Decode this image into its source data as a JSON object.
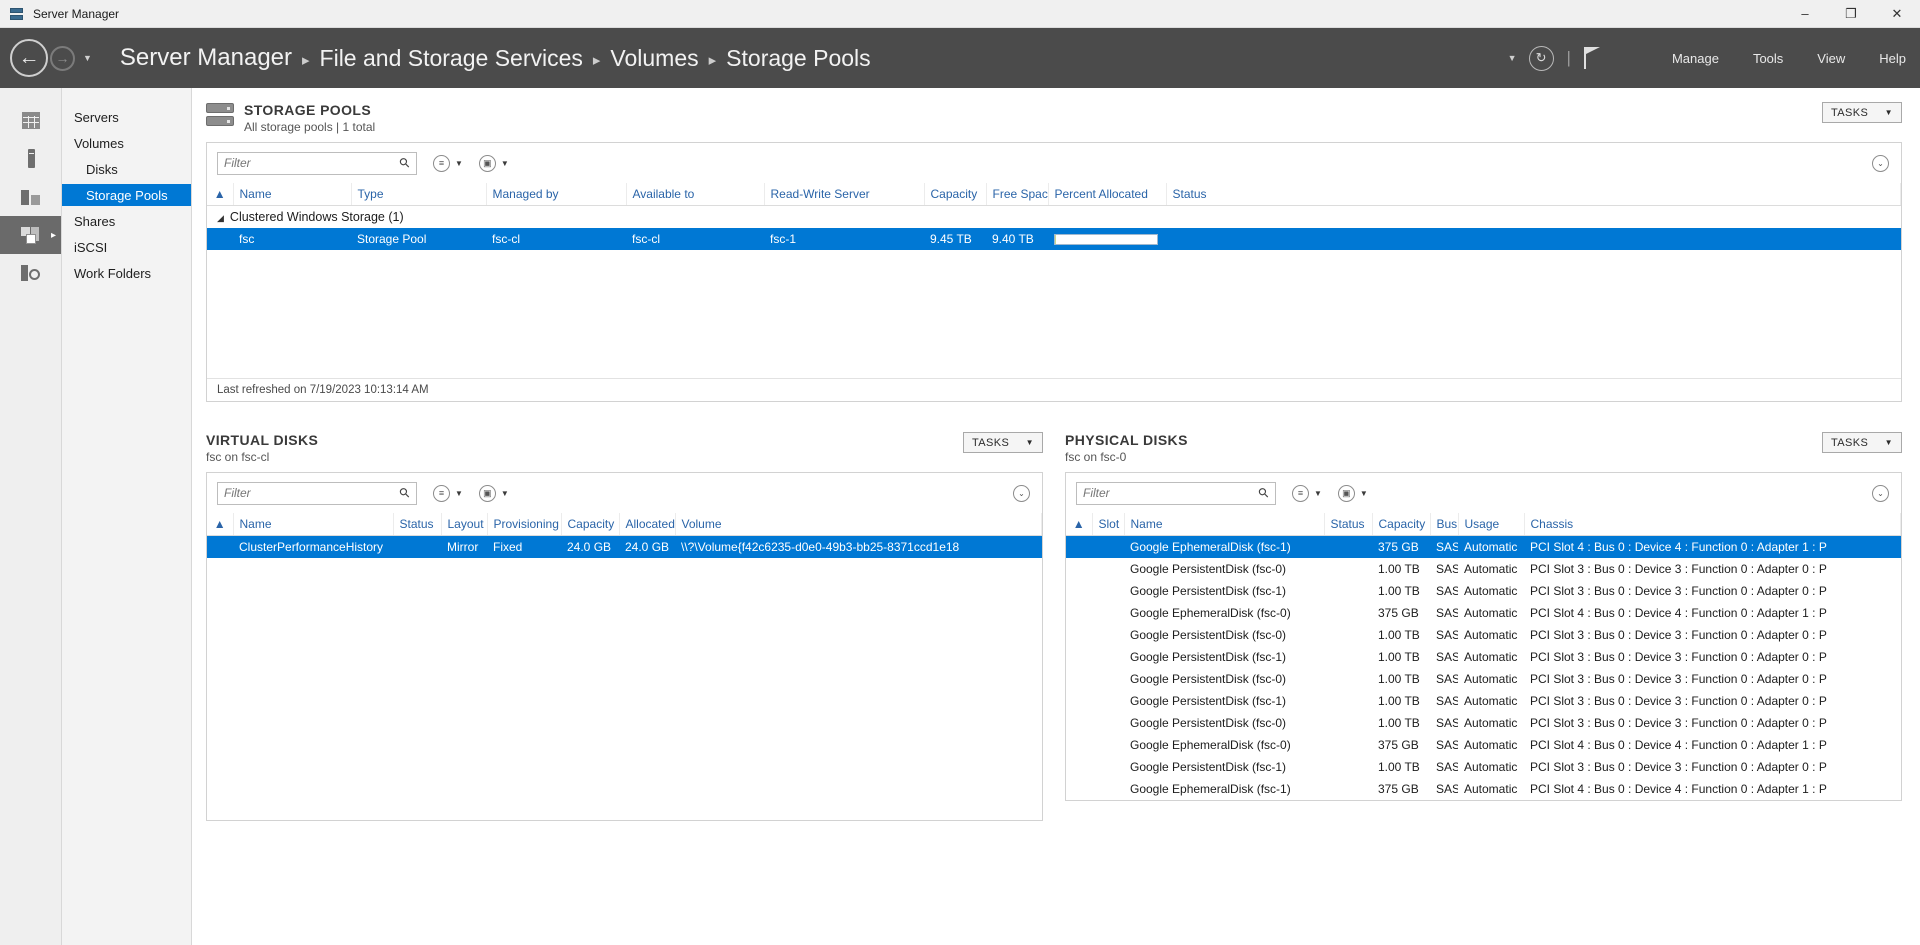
{
  "window": {
    "title": "Server Manager",
    "app_icon": "server-icon",
    "minimize": "–",
    "restore": "❐",
    "close": "✕"
  },
  "navbar": {
    "back_icon": "←",
    "forward_icon": "→",
    "dropdown_caret": "▼",
    "breadcrumb": [
      "Server Manager",
      "File and Storage Services",
      "Volumes",
      "Storage Pools"
    ],
    "separator": "▸",
    "notify_caret": "▼",
    "refresh_icon": "↻",
    "pipe": "|",
    "flag_icon": "flag-icon",
    "menu": [
      "Manage",
      "Tools",
      "View",
      "Help"
    ]
  },
  "iconrail": [
    {
      "name": "dashboard-icon"
    },
    {
      "name": "volumes-icon"
    },
    {
      "name": "disks-icon"
    },
    {
      "name": "storage-pools-icon",
      "active": true,
      "arrow": "▸"
    },
    {
      "name": "shares-icon"
    }
  ],
  "sidebar": {
    "items": [
      {
        "label": "Servers",
        "indent": false,
        "selected": false
      },
      {
        "label": "Volumes",
        "indent": false,
        "selected": false
      },
      {
        "label": "Disks",
        "indent": true,
        "selected": false
      },
      {
        "label": "Storage Pools",
        "indent": true,
        "selected": true
      },
      {
        "label": "Shares",
        "indent": false,
        "selected": false
      },
      {
        "label": "iSCSI",
        "indent": false,
        "selected": false
      },
      {
        "label": "Work Folders",
        "indent": false,
        "selected": false
      }
    ]
  },
  "storage_pools": {
    "title": "STORAGE POOLS",
    "subtitle": "All storage pools | 1 total",
    "tasks_label": "TASKS",
    "tasks_caret": "▼",
    "filter_placeholder": "Filter",
    "filter_value": "",
    "search_icon": "⚲",
    "list-icon": "≡",
    "save-icon": "▣",
    "caret": "▼",
    "collapse_icon": "⌄",
    "sort_icon": "▲",
    "columns": [
      "Name",
      "Type",
      "Managed by",
      "Available to",
      "Read-Write Server",
      "Capacity",
      "Free Space",
      "Percent Allocated",
      "Status"
    ],
    "group_label": "Clustered Windows Storage (1)",
    "group_caret": "◢",
    "rows": [
      {
        "name": "fsc",
        "type": "Storage Pool",
        "managed_by": "fsc-cl",
        "available_to": "fsc-cl",
        "read_write_server": "fsc-1",
        "capacity": "9.45 TB",
        "free_space": "9.40 TB",
        "percent_allocated": 1,
        "status": "",
        "selected": true
      }
    ],
    "last_refreshed": "Last refreshed on 7/19/2023 10:13:14 AM"
  },
  "virtual_disks": {
    "title": "VIRTUAL DISKS",
    "subtitle": "fsc on fsc-cl",
    "tasks_label": "TASKS",
    "tasks_caret": "▼",
    "filter_placeholder": "Filter",
    "filter_value": "",
    "search_icon": "⚲",
    "collapse_icon": "⌄",
    "sort_icon": "▲",
    "columns": [
      "Name",
      "Status",
      "Layout",
      "Provisioning",
      "Capacity",
      "Allocated",
      "Volume"
    ],
    "rows": [
      {
        "name": "ClusterPerformanceHistory",
        "status": "",
        "layout": "Mirror",
        "provisioning": "Fixed",
        "capacity": "24.0 GB",
        "allocated": "24.0 GB",
        "volume": "\\\\?\\Volume{f42c6235-d0e0-49b3-bb25-8371ccd1e18",
        "selected": true
      }
    ]
  },
  "physical_disks": {
    "title": "PHYSICAL DISKS",
    "subtitle": "fsc on fsc-0",
    "tasks_label": "TASKS",
    "tasks_caret": "▼",
    "filter_placeholder": "Filter",
    "filter_value": "",
    "search_icon": "⚲",
    "collapse_icon": "⌄",
    "sort_icon": "▲",
    "columns": [
      "Slot",
      "Name",
      "Status",
      "Capacity",
      "Bus",
      "Usage",
      "Chassis"
    ],
    "rows": [
      {
        "slot": "",
        "name": "Google EphemeralDisk (fsc-1)",
        "status": "",
        "capacity": "375 GB",
        "bus": "SAS",
        "usage": "Automatic",
        "chassis": "PCI Slot 4 : Bus 0 : Device 4 : Function 0 : Adapter 1 : P",
        "selected": true
      },
      {
        "slot": "",
        "name": "Google PersistentDisk (fsc-0)",
        "status": "",
        "capacity": "1.00 TB",
        "bus": "SAS",
        "usage": "Automatic",
        "chassis": "PCI Slot 3 : Bus 0 : Device 3 : Function 0 : Adapter 0 : P",
        "selected": false
      },
      {
        "slot": "",
        "name": "Google PersistentDisk (fsc-1)",
        "status": "",
        "capacity": "1.00 TB",
        "bus": "SAS",
        "usage": "Automatic",
        "chassis": "PCI Slot 3 : Bus 0 : Device 3 : Function 0 : Adapter 0 : P",
        "selected": false
      },
      {
        "slot": "",
        "name": "Google EphemeralDisk (fsc-0)",
        "status": "",
        "capacity": "375 GB",
        "bus": "SAS",
        "usage": "Automatic",
        "chassis": "PCI Slot 4 : Bus 0 : Device 4 : Function 0 : Adapter 1 : P",
        "selected": false
      },
      {
        "slot": "",
        "name": "Google PersistentDisk (fsc-0)",
        "status": "",
        "capacity": "1.00 TB",
        "bus": "SAS",
        "usage": "Automatic",
        "chassis": "PCI Slot 3 : Bus 0 : Device 3 : Function 0 : Adapter 0 : P",
        "selected": false
      },
      {
        "slot": "",
        "name": "Google PersistentDisk (fsc-1)",
        "status": "",
        "capacity": "1.00 TB",
        "bus": "SAS",
        "usage": "Automatic",
        "chassis": "PCI Slot 3 : Bus 0 : Device 3 : Function 0 : Adapter 0 : P",
        "selected": false
      },
      {
        "slot": "",
        "name": "Google PersistentDisk (fsc-0)",
        "status": "",
        "capacity": "1.00 TB",
        "bus": "SAS",
        "usage": "Automatic",
        "chassis": "PCI Slot 3 : Bus 0 : Device 3 : Function 0 : Adapter 0 : P",
        "selected": false
      },
      {
        "slot": "",
        "name": "Google PersistentDisk (fsc-1)",
        "status": "",
        "capacity": "1.00 TB",
        "bus": "SAS",
        "usage": "Automatic",
        "chassis": "PCI Slot 3 : Bus 0 : Device 3 : Function 0 : Adapter 0 : P",
        "selected": false
      },
      {
        "slot": "",
        "name": "Google PersistentDisk (fsc-0)",
        "status": "",
        "capacity": "1.00 TB",
        "bus": "SAS",
        "usage": "Automatic",
        "chassis": "PCI Slot 3 : Bus 0 : Device 3 : Function 0 : Adapter 0 : P",
        "selected": false
      },
      {
        "slot": "",
        "name": "Google EphemeralDisk (fsc-0)",
        "status": "",
        "capacity": "375 GB",
        "bus": "SAS",
        "usage": "Automatic",
        "chassis": "PCI Slot 4 : Bus 0 : Device 4 : Function 0 : Adapter 1 : P",
        "selected": false
      },
      {
        "slot": "",
        "name": "Google PersistentDisk (fsc-1)",
        "status": "",
        "capacity": "1.00 TB",
        "bus": "SAS",
        "usage": "Automatic",
        "chassis": "PCI Slot 3 : Bus 0 : Device 3 : Function 0 : Adapter 0 : P",
        "selected": false
      },
      {
        "slot": "",
        "name": "Google EphemeralDisk (fsc-1)",
        "status": "",
        "capacity": "375 GB",
        "bus": "SAS",
        "usage": "Automatic",
        "chassis": "PCI Slot 4 : Bus 0 : Device 4 : Function 0 : Adapter 1 : P",
        "selected": false
      }
    ]
  },
  "colors": {
    "accent": "#0078d4",
    "navbar": "#4b4b4b",
    "header_link": "#2a64a8",
    "bar_fill": "#c9d98f"
  }
}
